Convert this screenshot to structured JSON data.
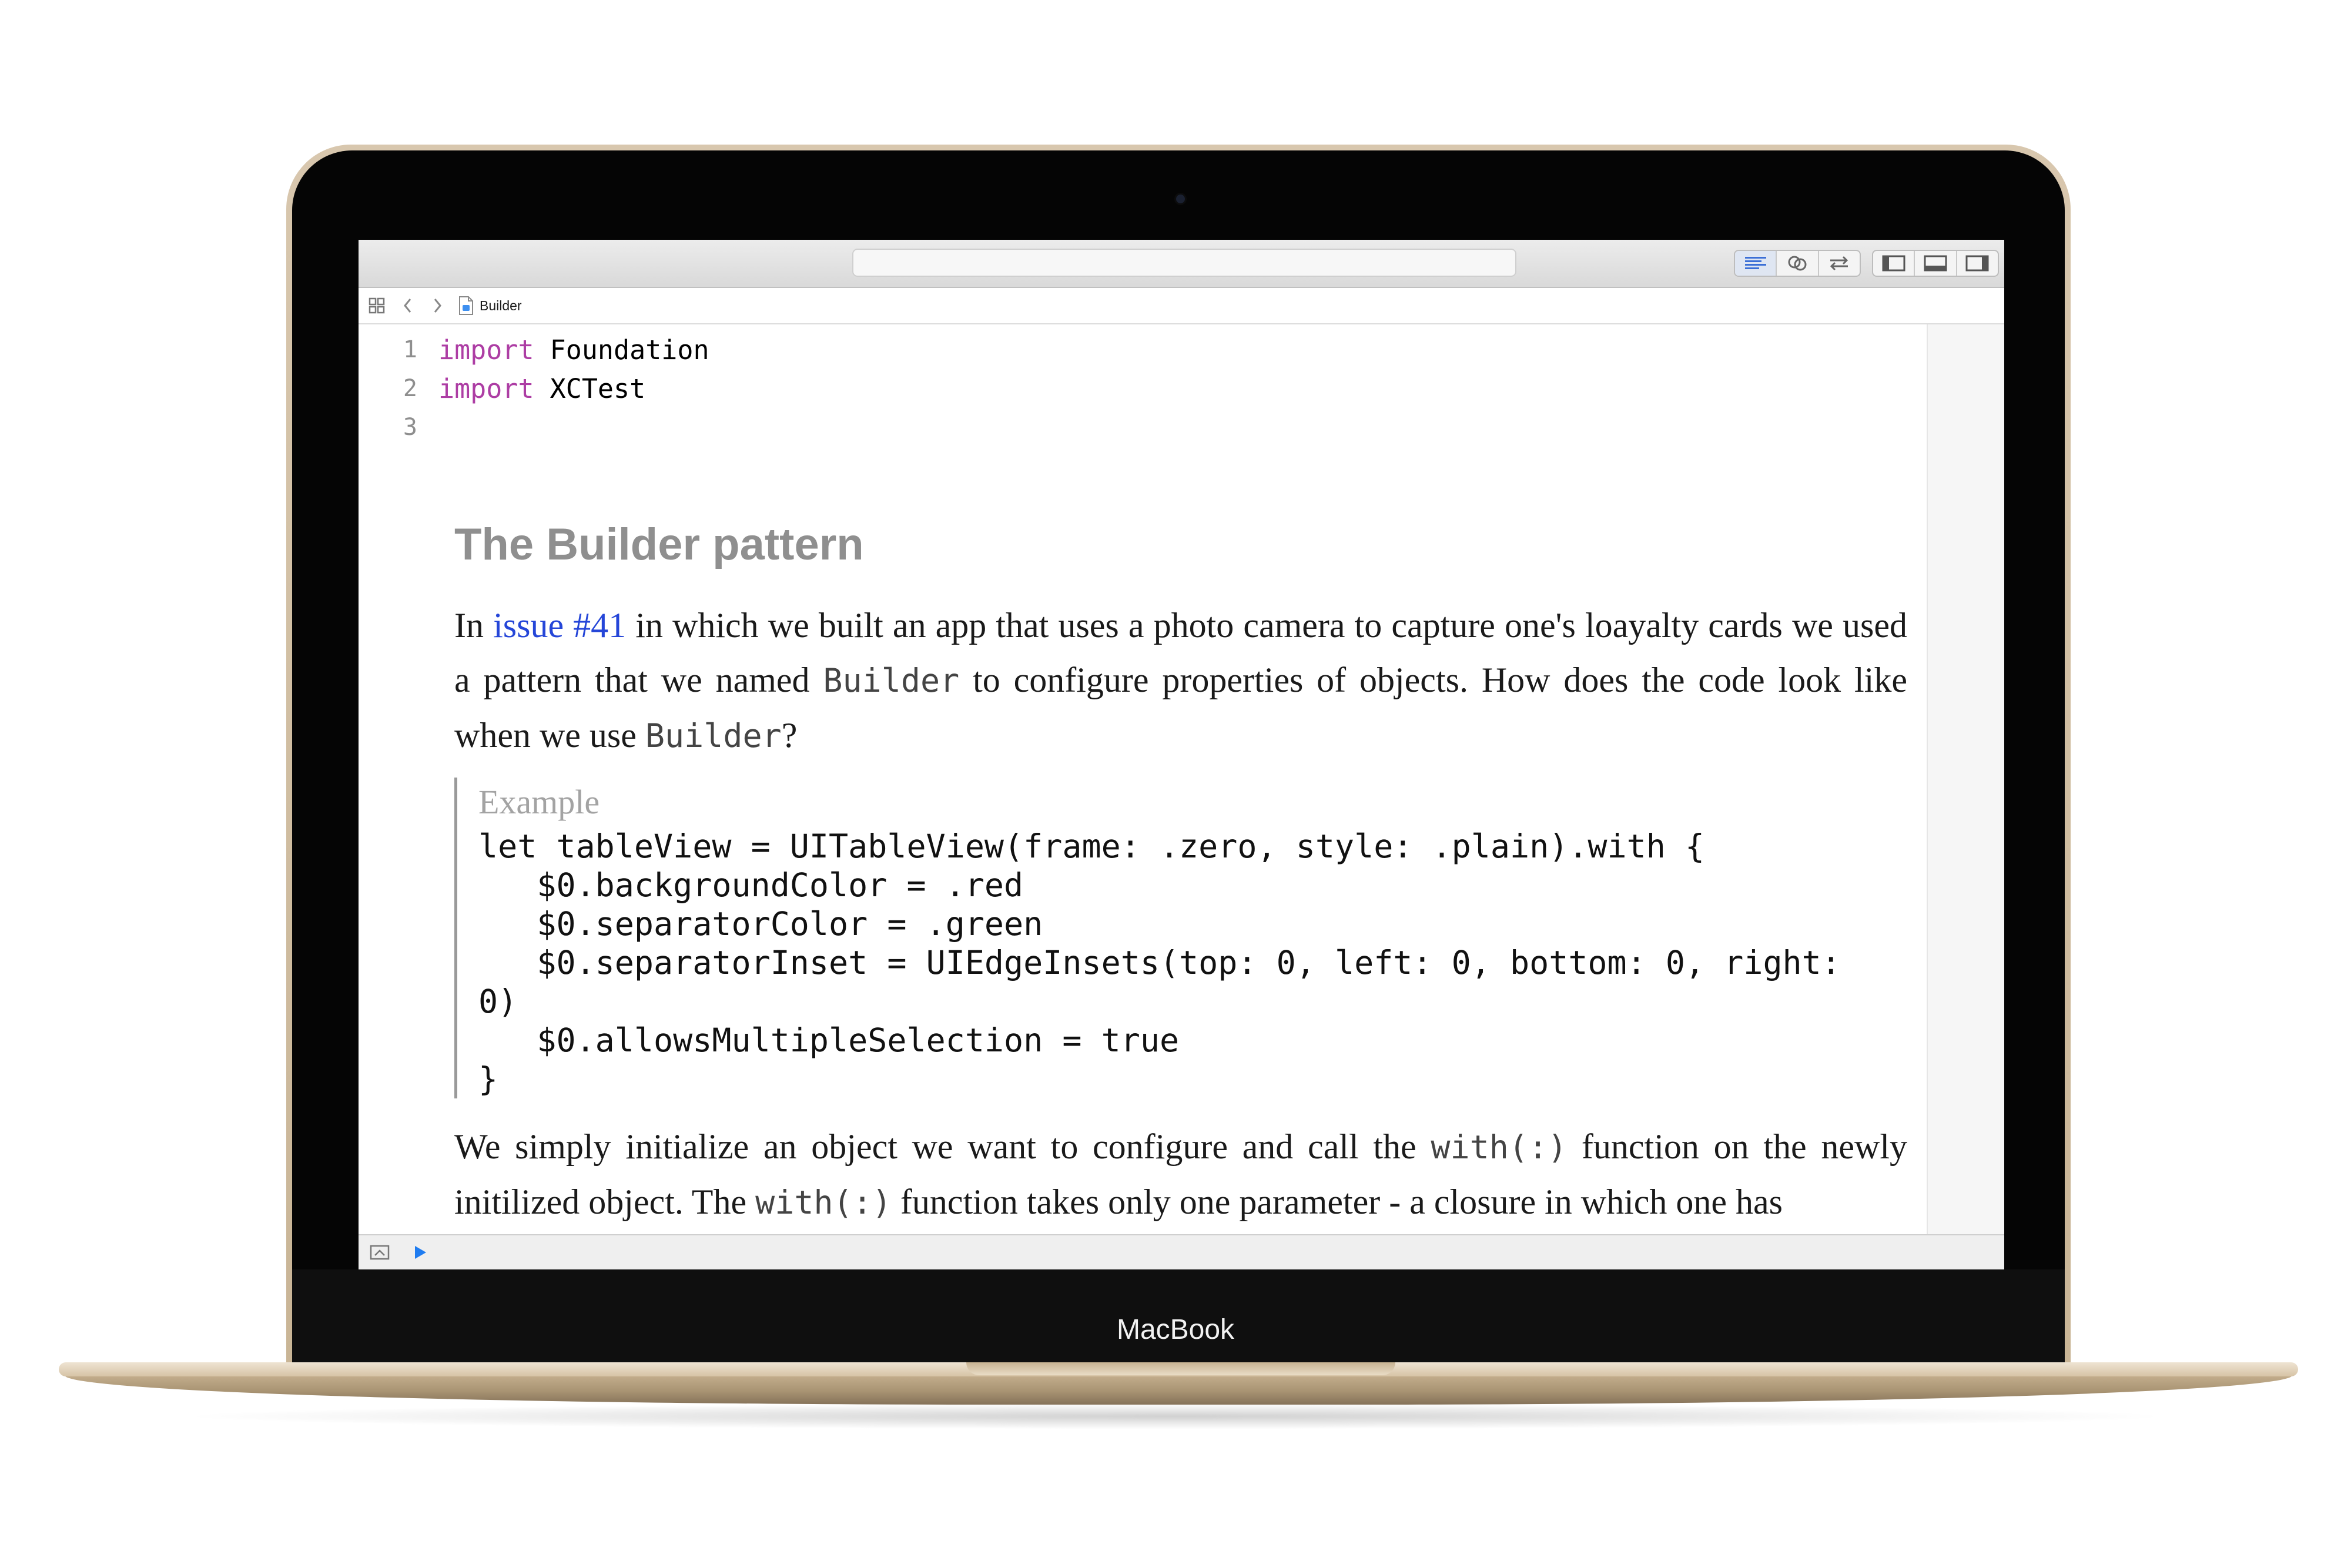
{
  "device": {
    "brand": "MacBook"
  },
  "window": {
    "jump_bar": {
      "file_name": "Builder"
    }
  },
  "editor": {
    "code_lines": [
      {
        "number": "1",
        "keyword": "import",
        "module": "Foundation"
      },
      {
        "number": "2",
        "keyword": "import",
        "module": "XCTest"
      },
      {
        "number": "3",
        "keyword": "",
        "module": ""
      }
    ]
  },
  "doc": {
    "title": "The Builder pattern",
    "para1": {
      "t1": "In ",
      "link": "issue #41",
      "t2": " in which we built an app that uses a photo camera to capture one's loayalty cards we used a pattern that we named ",
      "code1": "Builder",
      "t3": " to configure properties of objects. How does the code look like when we use ",
      "code2": "Builder",
      "t4": "?"
    },
    "example": {
      "label": "Example",
      "code": "let tableView = UITableView(frame: .zero, style: .plain).with {\n   $0.backgroundColor = .red\n   $0.separatorColor = .green\n   $0.separatorInset = UIEdgeInsets(top: 0, left: 0, bottom: 0, right:\n0)\n   $0.allowsMultipleSelection = true\n}"
    },
    "para2": {
      "t1": "We simply initialize an object we want to configure and call the ",
      "code1": "with(:)",
      "t2": " function on the newly initilized object. The ",
      "code2": "with(:)",
      "t3": " function takes only one parameter - a closure in which one has"
    }
  },
  "colors": {
    "keyword": "#ad3da4",
    "link": "#2546d8",
    "run_button": "#1f7cf0"
  }
}
